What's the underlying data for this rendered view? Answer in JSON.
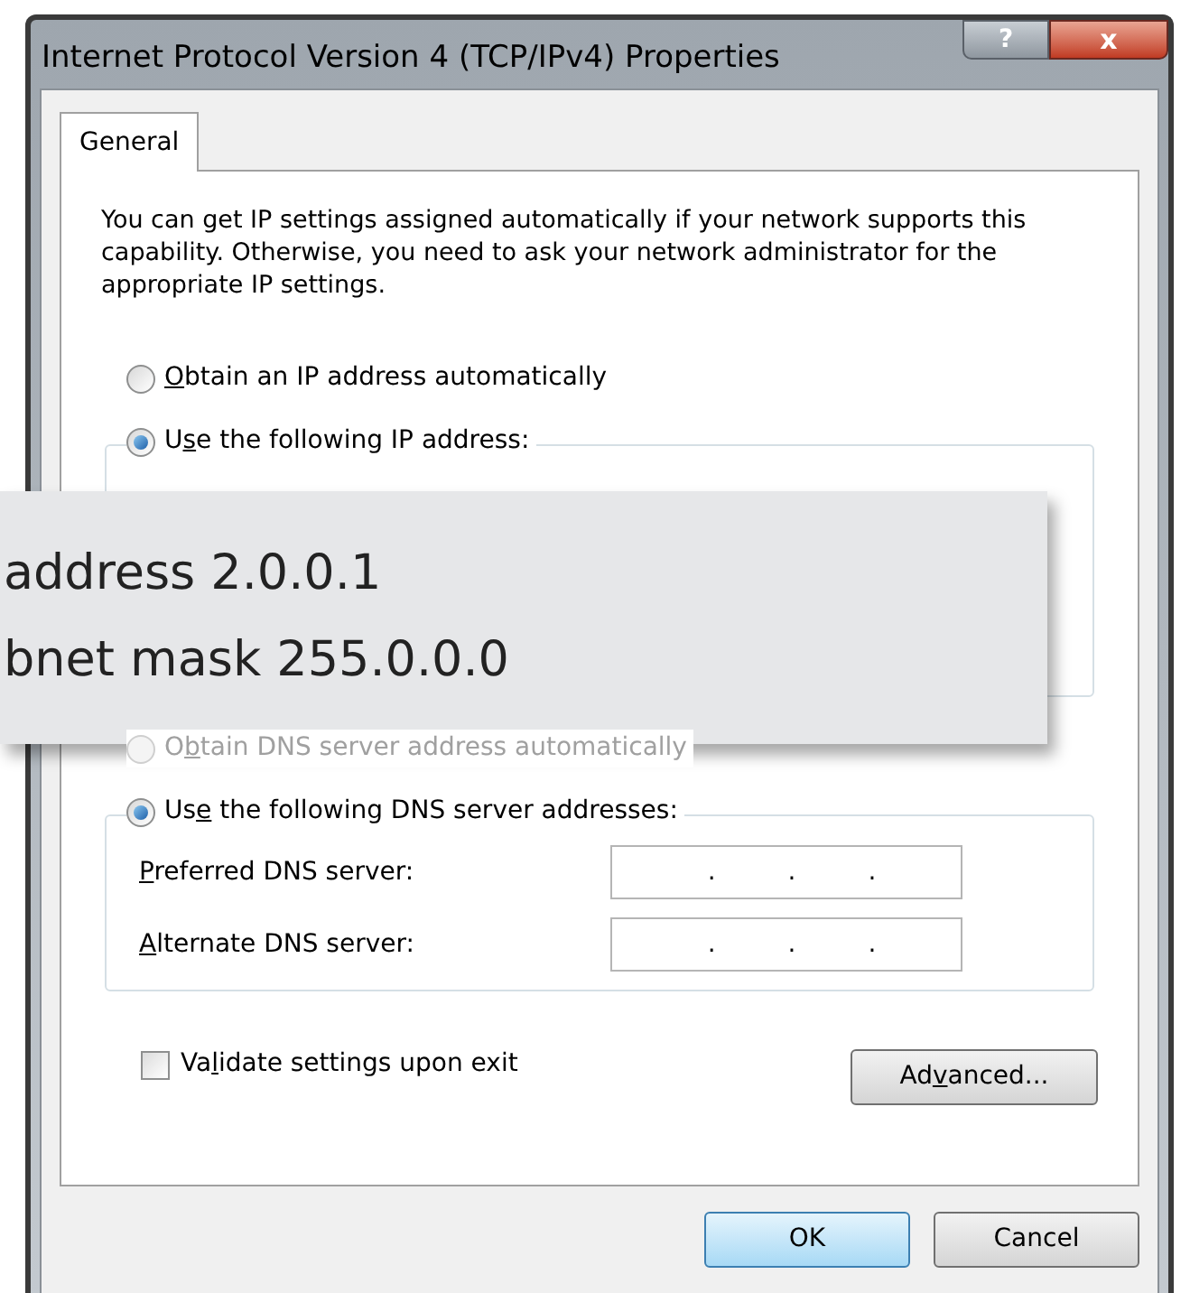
{
  "window": {
    "title": "Internet Protocol Version 4 (TCP/IPv4) Properties",
    "buttons": [
      {
        "kind": "help",
        "label": "?"
      },
      {
        "kind": "close",
        "label": "x"
      }
    ]
  },
  "tabs": [
    {
      "label": "General",
      "selected": true
    }
  ],
  "description": "You can get IP settings assigned automatically if your network supports this capability. Otherwise, you need to ask your network administrator for the appropriate IP settings.",
  "ip_options": [
    {
      "label": {
        "key": "O",
        "after": "btain an IP address automatically"
      },
      "selected": false,
      "disabled": false
    },
    {
      "label": {
        "before": "U",
        "key": "s",
        "after": "e the following IP address:"
      },
      "selected": true,
      "disabled": false
    }
  ],
  "callout": {
    "lines": [
      "address 2.0.0.1",
      "bnet mask 255.0.0.0"
    ]
  },
  "dns_options": [
    {
      "label": {
        "before": "O",
        "key": "b",
        "after": "tain DNS server address automatically"
      },
      "selected": false,
      "disabled": true
    },
    {
      "label": {
        "before": "Us",
        "key": "e",
        "after": " the following DNS server addresses:"
      },
      "selected": true,
      "disabled": false
    }
  ],
  "dns_fields": [
    {
      "label": {
        "key": "P",
        "after": "referred DNS server:"
      },
      "separators": [
        ".",
        ".",
        "."
      ]
    },
    {
      "label": {
        "key": "A",
        "after": "lternate DNS server:"
      },
      "separators": [
        ".",
        ".",
        "."
      ]
    }
  ],
  "validate": {
    "label": {
      "before": "Va",
      "key": "l",
      "after": "idate settings upon exit"
    },
    "checked": false
  },
  "advanced_button": {
    "label": {
      "before": "Ad",
      "key": "v",
      "after": "anced..."
    }
  },
  "footer_buttons": [
    {
      "label": "OK",
      "default": true
    },
    {
      "label": "Cancel",
      "default": false
    }
  ]
}
